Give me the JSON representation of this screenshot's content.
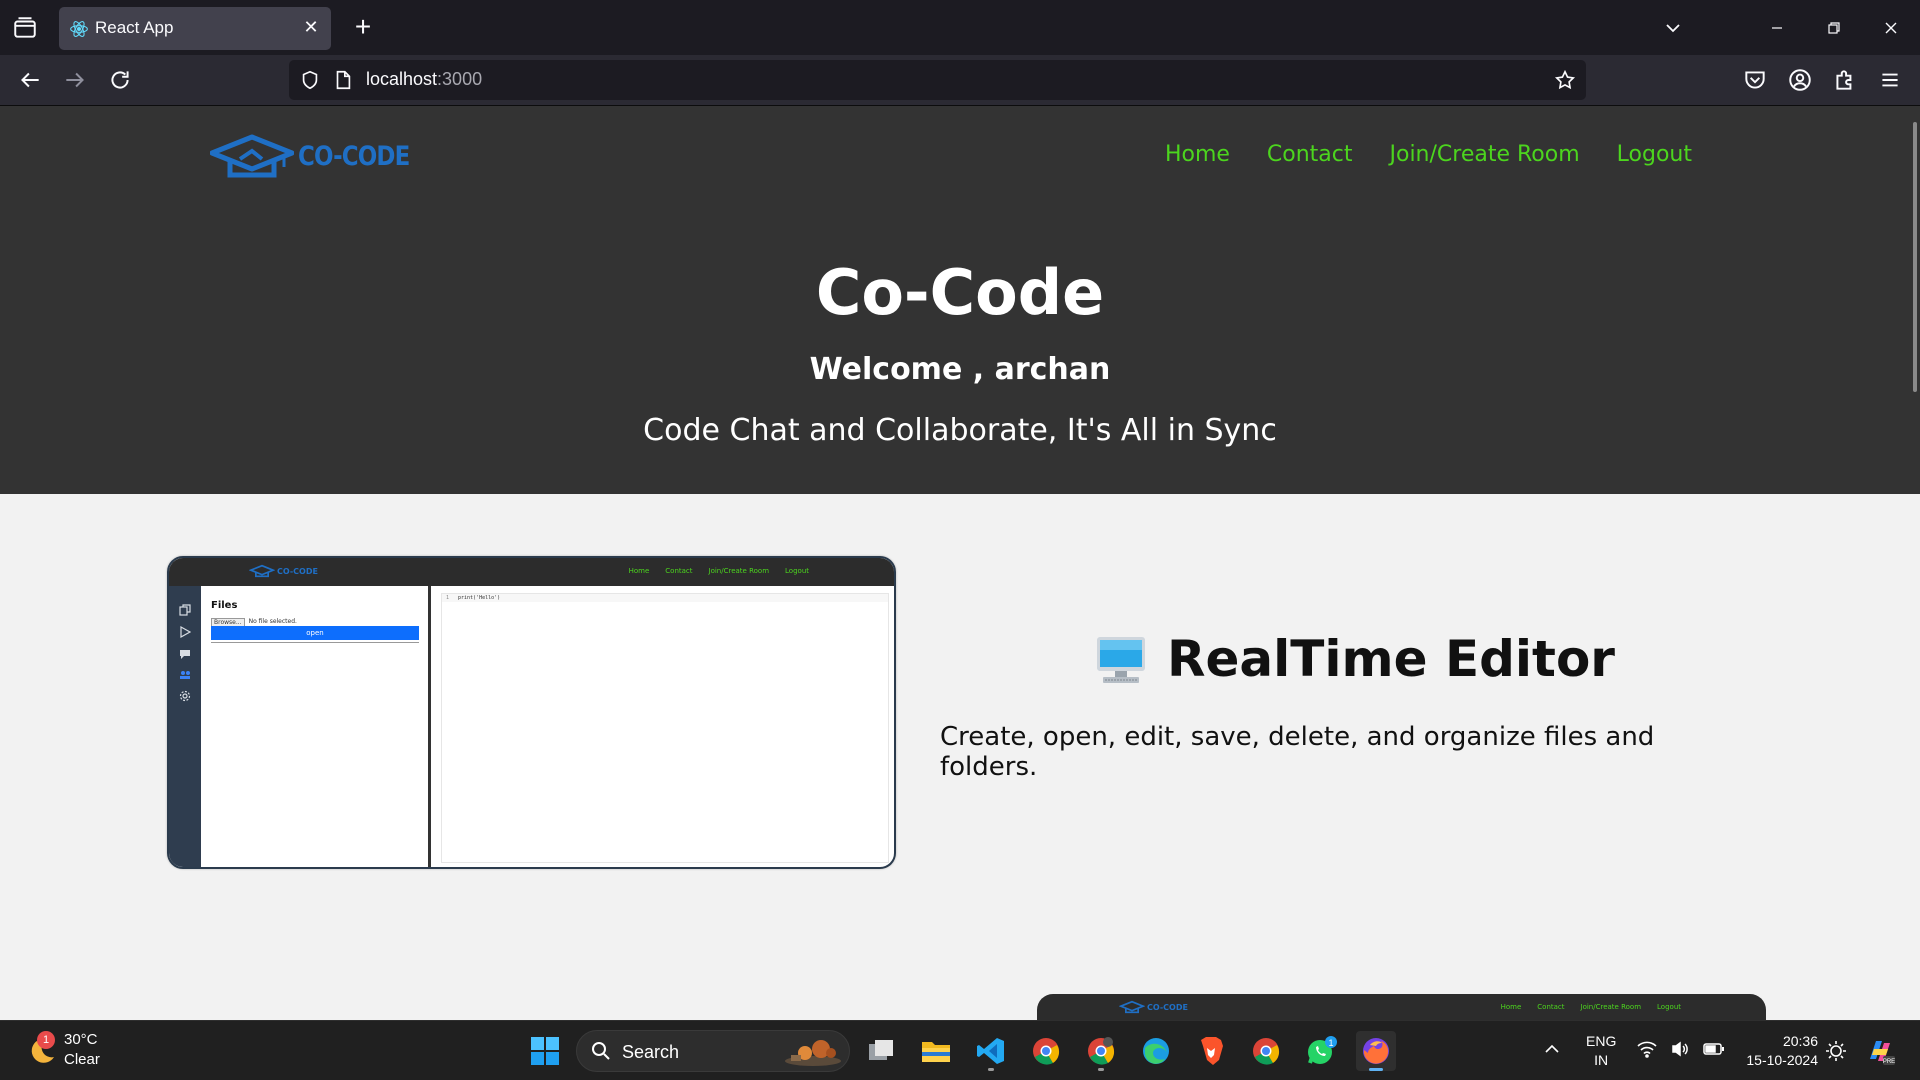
{
  "browser": {
    "tab_title": "React App",
    "url_host": "localhost",
    "url_port": ":3000"
  },
  "site": {
    "logo_text": "CO-CODE",
    "nav": [
      "Home",
      "Contact",
      "Join/Create Room",
      "Logout"
    ],
    "hero_title": "Co-Code",
    "welcome": "Welcome , archan",
    "tagline": "Code Chat and Collaborate, It's All in Sync",
    "accent_green": "#4cd51e",
    "logo_blue": "#1f6fc5"
  },
  "preview": {
    "files_heading": "Files",
    "browse_label": "Browse...",
    "no_file": "No file selected.",
    "open_label": "open",
    "line_number": "1",
    "code_line": "print('Hello')"
  },
  "feature": {
    "title": "RealTime Editor",
    "description": "Create, open, edit, save, delete, and organize files and folders."
  },
  "taskbar": {
    "weather_badge": "1",
    "temperature": "30°C",
    "condition": "Clear",
    "search_label": "Search",
    "whatsapp_badge": "1",
    "lang_line1": "ENG",
    "lang_line2": "IN",
    "time": "20:36",
    "date": "15-10-2024"
  }
}
